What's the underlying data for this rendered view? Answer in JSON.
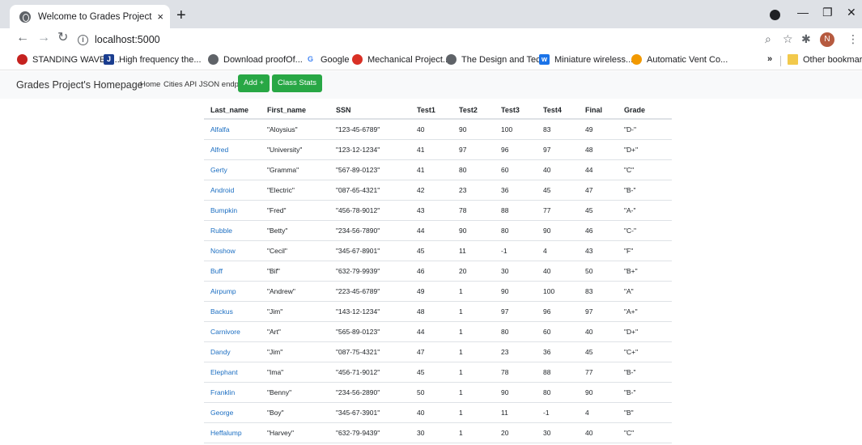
{
  "browser": {
    "tab_title": "Welcome to Grades Project's site",
    "tab_close": "×",
    "new_tab": "+",
    "url": "localhost:5000",
    "avatar_letter": "N",
    "bookmarks": [
      {
        "label": "STANDING WAVE T...",
        "icon": "red-circle-icon",
        "color": "#c5221f"
      },
      {
        "label": "High frequency the...",
        "icon": "j-icon",
        "color": "#1a3d8f"
      },
      {
        "label": "Download proofOf...",
        "icon": "globe-icon",
        "color": "#5f6368"
      },
      {
        "label": "Google",
        "icon": "google-icon",
        "color": "#4285f4"
      },
      {
        "label": "Mechanical Project...",
        "icon": "gear-logo-icon",
        "color": "#d93025"
      },
      {
        "label": "The Design and Tec...",
        "icon": "globe-icon",
        "color": "#5f6368"
      },
      {
        "label": "Miniature wireless...",
        "icon": "w-icon",
        "color": "#1a73e8"
      },
      {
        "label": "Automatic Vent Co...",
        "icon": "orange-icon",
        "color": "#f29900"
      }
    ],
    "more_bookmarks": "»",
    "other_bookmarks": "Other bookmarks"
  },
  "nav": {
    "brand": "Grades Project's Homepage",
    "home": "Home",
    "cities": "Cities API JSON endpoint",
    "add": "Add +",
    "stats": "Class Stats",
    "accent": "#28a745"
  },
  "table": {
    "headers": [
      "Last_name",
      "First_name",
      "SSN",
      "Test1",
      "Test2",
      "Test3",
      "Test4",
      "Final",
      "Grade"
    ],
    "rows": [
      [
        "Alfalfa",
        "\"Aloysius\"",
        "\"123-45-6789\"",
        "40",
        "90",
        "100",
        "83",
        "49",
        "\"D-\""
      ],
      [
        "Alfred",
        "\"University\"",
        "\"123-12-1234\"",
        "41",
        "97",
        "96",
        "97",
        "48",
        "\"D+\""
      ],
      [
        "Gerty",
        "\"Gramma\"",
        "\"567-89-0123\"",
        "41",
        "80",
        "60",
        "40",
        "44",
        "\"C\""
      ],
      [
        "Android",
        "\"Electric\"",
        "\"087-65-4321\"",
        "42",
        "23",
        "36",
        "45",
        "47",
        "\"B-\""
      ],
      [
        "Bumpkin",
        "\"Fred\"",
        "\"456-78-9012\"",
        "43",
        "78",
        "88",
        "77",
        "45",
        "\"A-\""
      ],
      [
        "Rubble",
        "\"Betty\"",
        "\"234-56-7890\"",
        "44",
        "90",
        "80",
        "90",
        "46",
        "\"C-\""
      ],
      [
        "Noshow",
        "\"Cecil\"",
        "\"345-67-8901\"",
        "45",
        "11",
        "-1",
        "4",
        "43",
        "\"F\""
      ],
      [
        "Buff",
        "\"Bif\"",
        "\"632-79-9939\"",
        "46",
        "20",
        "30",
        "40",
        "50",
        "\"B+\""
      ],
      [
        "Airpump",
        "\"Andrew\"",
        "\"223-45-6789\"",
        "49",
        "1",
        "90",
        "100",
        "83",
        "\"A\""
      ],
      [
        "Backus",
        "\"Jim\"",
        "\"143-12-1234\"",
        "48",
        "1",
        "97",
        "96",
        "97",
        "\"A+\""
      ],
      [
        "Carnivore",
        "\"Art\"",
        "\"565-89-0123\"",
        "44",
        "1",
        "80",
        "60",
        "40",
        "\"D+\""
      ],
      [
        "Dandy",
        "\"Jim\"",
        "\"087-75-4321\"",
        "47",
        "1",
        "23",
        "36",
        "45",
        "\"C+\""
      ],
      [
        "Elephant",
        "\"Ima\"",
        "\"456-71-9012\"",
        "45",
        "1",
        "78",
        "88",
        "77",
        "\"B-\""
      ],
      [
        "Franklin",
        "\"Benny\"",
        "\"234-56-2890\"",
        "50",
        "1",
        "90",
        "80",
        "90",
        "\"B-\""
      ],
      [
        "George",
        "\"Boy\"",
        "\"345-67-3901\"",
        "40",
        "1",
        "11",
        "-1",
        "4",
        "\"B\""
      ],
      [
        "Heffalump",
        "\"Harvey\"",
        "\"632-79-9439\"",
        "30",
        "1",
        "20",
        "30",
        "40",
        "\"C\""
      ]
    ]
  }
}
